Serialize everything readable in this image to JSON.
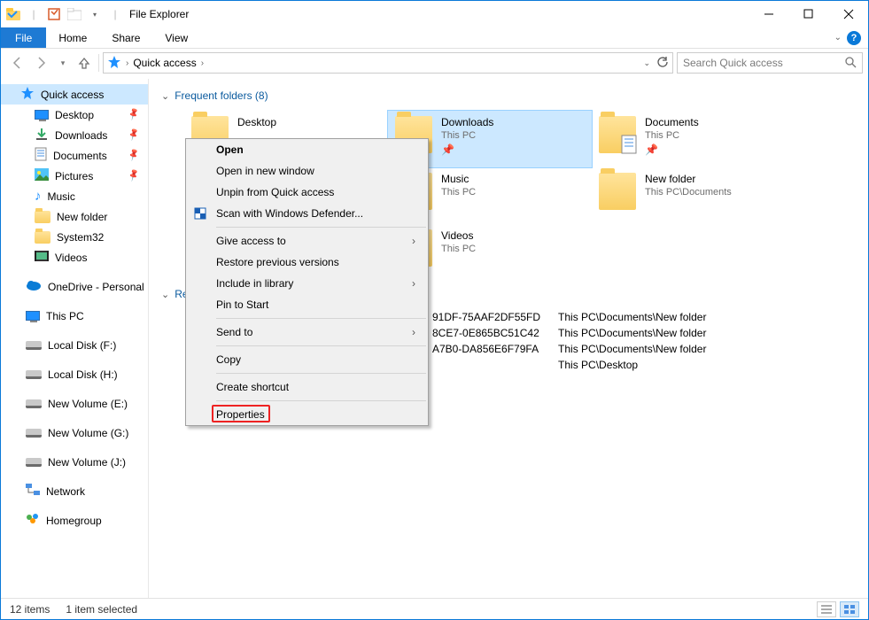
{
  "window": {
    "title": "File Explorer",
    "qat_sep": "|"
  },
  "ribbon": {
    "file": "File",
    "tabs": [
      "Home",
      "Share",
      "View"
    ]
  },
  "address": {
    "crumb1": "Quick access",
    "sep": "›"
  },
  "search": {
    "placeholder": "Search Quick access"
  },
  "sidebar": {
    "quick": "Quick access",
    "items": [
      {
        "label": "Desktop",
        "pin": true,
        "icon": "monitor"
      },
      {
        "label": "Downloads",
        "pin": true,
        "icon": "download"
      },
      {
        "label": "Documents",
        "pin": true,
        "icon": "doc"
      },
      {
        "label": "Pictures",
        "pin": true,
        "icon": "pic"
      },
      {
        "label": "Music",
        "pin": false,
        "icon": "music"
      },
      {
        "label": "New folder",
        "pin": false,
        "icon": "folder"
      },
      {
        "label": "System32",
        "pin": false,
        "icon": "folder"
      },
      {
        "label": "Videos",
        "pin": false,
        "icon": "video"
      }
    ],
    "onedrive": "OneDrive - Personal",
    "thispc": "This PC",
    "drives": [
      "Local Disk (F:)",
      "Local Disk (H:)",
      "New Volume (E:)",
      "New Volume (G:)",
      "New Volume (J:)"
    ],
    "network": "Network",
    "homegroup": "Homegroup"
  },
  "sections": {
    "frequent": "Frequent folders (8)",
    "recent": "Rec"
  },
  "folders": [
    {
      "name": "Desktop",
      "sub": "",
      "icon": "desktop"
    },
    {
      "name": "Downloads",
      "sub": "This PC",
      "icon": "download",
      "selected": true
    },
    {
      "name": "Documents",
      "sub": "This PC",
      "icon": "doc"
    },
    {
      "name": "",
      "sub": "",
      "hidden": true
    },
    {
      "name": "Music",
      "sub": "This PC",
      "icon": "music"
    },
    {
      "name": "New folder",
      "sub": "This PC\\Documents",
      "icon": "folder"
    },
    {
      "name": "",
      "sub": "",
      "hidden": true
    },
    {
      "name": "Videos",
      "sub": "This PC",
      "icon": "video"
    }
  ],
  "recent_rows": [
    {
      "tail": "91DF-75AAF2DF55FD",
      "loc": "This PC\\Documents\\New folder"
    },
    {
      "tail": "8CE7-0E865BC51C42",
      "loc": "This PC\\Documents\\New folder"
    },
    {
      "tail": "A7B0-DA856E6F79FA",
      "loc": "This PC\\Documents\\New folder"
    },
    {
      "tail": "",
      "loc": "This PC\\Desktop"
    }
  ],
  "ctx": {
    "open": "Open",
    "open_new": "Open in new window",
    "unpin": "Unpin from Quick access",
    "defender": "Scan with Windows Defender...",
    "give_access": "Give access to",
    "restore": "Restore previous versions",
    "include": "Include in library",
    "pin_start": "Pin to Start",
    "send_to": "Send to",
    "copy": "Copy",
    "shortcut": "Create shortcut",
    "properties": "Properties"
  },
  "status": {
    "items": "12 items",
    "selected": "1 item selected"
  }
}
